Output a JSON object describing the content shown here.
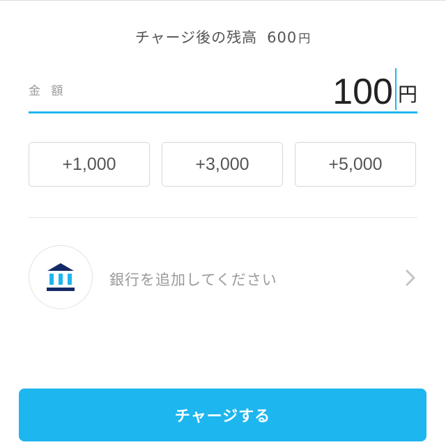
{
  "balance": {
    "label": "チャージ後の残高",
    "amount": "600",
    "unit": "円"
  },
  "amount_field": {
    "label": "金 額",
    "value": "100",
    "unit": "円"
  },
  "presets": [
    {
      "label": "+1,000"
    },
    {
      "label": "+3,000"
    },
    {
      "label": "+5,000"
    }
  ],
  "bank": {
    "icon": "bank-icon",
    "label": "銀行を追加してください"
  },
  "charge_button": {
    "label": "チャージする"
  },
  "colors": {
    "accent": "#1eb6ef",
    "bank_icon_dark": "#142a66"
  }
}
